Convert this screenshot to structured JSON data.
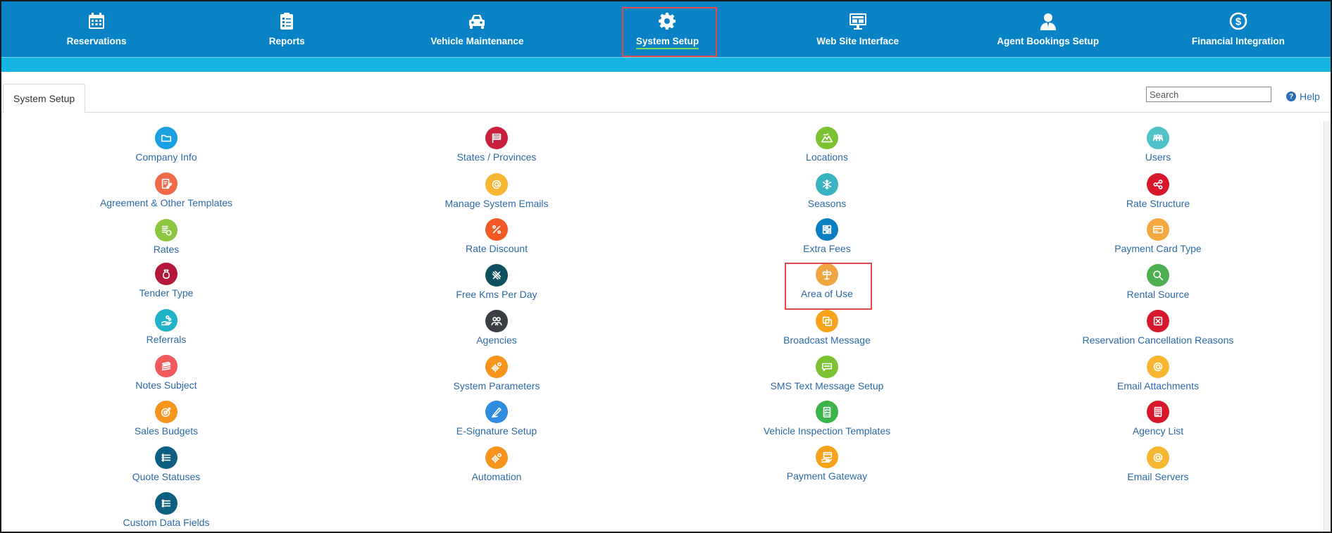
{
  "nav": {
    "items": [
      {
        "label": "Reservations",
        "icon": "calendar-icon"
      },
      {
        "label": "Reports",
        "icon": "clipboard-icon"
      },
      {
        "label": "Vehicle Maintenance",
        "icon": "car-icon"
      },
      {
        "label": "System Setup",
        "icon": "gear-icon",
        "active": true
      },
      {
        "label": "Web Site Interface",
        "icon": "monitor-icon"
      },
      {
        "label": "Agent Bookings Setup",
        "icon": "agent-icon"
      },
      {
        "label": "Financial Integration",
        "icon": "dollar-refresh-icon"
      }
    ]
  },
  "tab": {
    "label": "System Setup"
  },
  "search": {
    "placeholder": "Search",
    "value": ""
  },
  "help": {
    "label": "Help",
    "icon": "question-icon"
  },
  "grid": {
    "columns": [
      {
        "items": [
          {
            "label": "Company Info",
            "color": "#1ba1e2",
            "icon": "folder-icon"
          },
          {
            "label": "Agreement & Other Templates",
            "color": "#f06a4a",
            "icon": "edit-document-icon"
          },
          {
            "label": "Rates",
            "color": "#8cc63f",
            "icon": "rates-document-icon"
          },
          {
            "label": "Tender Type",
            "color": "#b5173a",
            "icon": "money-bag-icon"
          },
          {
            "label": "Referrals",
            "color": "#20b2c6",
            "icon": "hand-coins-icon"
          },
          {
            "label": "Notes Subject",
            "color": "#f05a5a",
            "icon": "notes-stack-icon"
          },
          {
            "label": "Sales Budgets",
            "color": "#f7941d",
            "icon": "target-icon"
          },
          {
            "label": "Quote Statuses",
            "color": "#0e5f7f",
            "icon": "list-icon"
          },
          {
            "label": "Custom Data Fields",
            "color": "#0e5f7f",
            "icon": "list-icon"
          }
        ]
      },
      {
        "items": [
          {
            "label": "States / Provinces",
            "color": "#c8203a",
            "icon": "flag-icon"
          },
          {
            "label": "Manage System Emails",
            "color": "#f7b733",
            "icon": "at-icon"
          },
          {
            "label": "Rate Discount",
            "color": "#f15a24",
            "icon": "percent-icon"
          },
          {
            "label": "Free Kms Per Day",
            "color": "#0e4f60",
            "icon": "road-icon"
          },
          {
            "label": "Agencies",
            "color": "#3b3f45",
            "icon": "people-icon"
          },
          {
            "label": "System Parameters",
            "color": "#f7941d",
            "icon": "gears-icon"
          },
          {
            "label": "E-Signature Setup",
            "color": "#2f8ce0",
            "icon": "pen-icon"
          },
          {
            "label": "Automation",
            "color": "#f7941d",
            "icon": "gears-icon"
          }
        ]
      },
      {
        "items": [
          {
            "label": "Locations",
            "color": "#7ac231",
            "icon": "map-icon"
          },
          {
            "label": "Seasons",
            "color": "#3bb4c1",
            "icon": "snowflake-icon"
          },
          {
            "label": "Extra Fees",
            "color": "#0b7fc0",
            "icon": "calculator-icon"
          },
          {
            "label": "Area of Use",
            "color": "#f0a543",
            "icon": "signpost-icon",
            "highlight": true
          },
          {
            "label": "Broadcast Message",
            "color": "#f7a21b",
            "icon": "copy-icon"
          },
          {
            "label": "SMS Text Message Setup",
            "color": "#7ac231",
            "icon": "sms-icon"
          },
          {
            "label": "Vehicle Inspection Templates",
            "color": "#39b54a",
            "icon": "checklist-icon"
          },
          {
            "label": "Payment Gateway",
            "color": "#f7a21b",
            "icon": "card-hand-icon"
          }
        ]
      },
      {
        "items": [
          {
            "label": "Users",
            "color": "#4fc1c9",
            "icon": "users-icon"
          },
          {
            "label": "Rate Structure",
            "color": "#d7182a",
            "icon": "network-icon"
          },
          {
            "label": "Payment Card Type",
            "color": "#f4a940",
            "icon": "credit-card-icon"
          },
          {
            "label": "Rental Source",
            "color": "#4caf50",
            "icon": "magnifier-icon"
          },
          {
            "label": "Reservation Cancellation Reasons",
            "color": "#d7182a",
            "icon": "cancel-icon"
          },
          {
            "label": "Email Attachments",
            "color": "#f7b733",
            "icon": "at-icon"
          },
          {
            "label": "Agency List",
            "color": "#d7182a",
            "icon": "document-list-icon"
          },
          {
            "label": "Email Servers",
            "color": "#f7b733",
            "icon": "at-icon"
          }
        ]
      }
    ]
  }
}
